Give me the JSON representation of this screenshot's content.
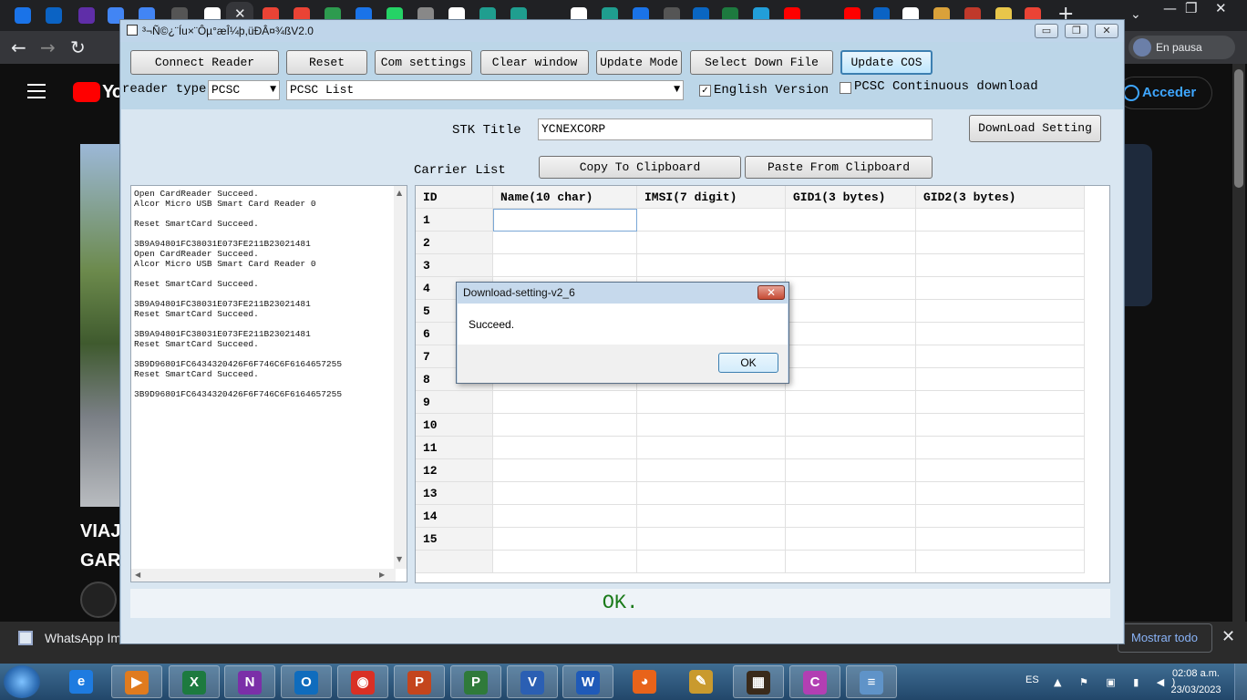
{
  "browser": {
    "active_tab_close": "✕",
    "new_tab": "+",
    "tab_search": "⌄",
    "window_controls": [
      "—",
      "❐",
      "✕"
    ],
    "nav": {
      "back": "←",
      "forward": "→",
      "reload": "↻"
    },
    "profile_status": "En pausa"
  },
  "youtube": {
    "logo_text": "Yo",
    "login_label": "Acceder",
    "video_title_line1": "VIAJ",
    "video_title_line2": "GAR"
  },
  "download_bar": {
    "file_name": "WhatsApp Ima",
    "show_all": "Mostrar todo",
    "close": "✕"
  },
  "app": {
    "title": "³¬Ñ©¿¨Íu×¨Ôµ°æÎ¼þ,üÐÂ¤¾ßV2.0",
    "controls": [
      "▭",
      "❐",
      "✕"
    ],
    "buttons": {
      "connect_reader": "Connect Reader",
      "reset": "Reset",
      "com_settings": "Com settings",
      "clear_window": "Clear window",
      "update_mode": "Update Mode",
      "select_down_file": "Select Down File",
      "update_cos": "Update COS",
      "download_setting": "DownLoad Setting",
      "copy_to_clipboard": "Copy To Clipboard",
      "paste_from_clipboard": "Paste From Clipboard"
    },
    "reader_type_label": "reader type",
    "reader_type_value": "PCSC",
    "reader_list_value": "PCSC List",
    "english_version_label": "English Version",
    "english_version_checked": true,
    "pcsc_continuous_label": "PCSC Continuous download",
    "pcsc_continuous_checked": false,
    "stk_title_label": "STK Title",
    "stk_title_value": "YCNEXCORP",
    "carrier_list_label": "Carrier List",
    "log_lines": [
      "Open CardReader Succeed.",
      "Alcor Micro USB Smart Card Reader 0",
      "",
      "Reset SmartCard Succeed.",
      "",
      "3B9A94801FC38031E073FE211B23021481",
      "Open CardReader Succeed.",
      "Alcor Micro USB Smart Card Reader 0",
      "",
      "Reset SmartCard Succeed.",
      "",
      "3B9A94801FC38031E073FE211B23021481",
      "Reset SmartCard Succeed.",
      "",
      "3B9A94801FC38031E073FE211B23021481",
      "Reset SmartCard Succeed.",
      "",
      "3B9D96801FC6434320426F6F746C6F6164657255",
      "Reset SmartCard Succeed.",
      "",
      "3B9D96801FC6434320426F6F746C6F6164657255"
    ],
    "grid": {
      "columns": [
        "ID",
        "Name(10 char)",
        "IMSI(7 digit)",
        "GID1(3 bytes)",
        "GID2(3 bytes)"
      ],
      "row_ids": [
        "1",
        "2",
        "3",
        "4",
        "5",
        "6",
        "7",
        "8",
        "9",
        "10",
        "11",
        "12",
        "13",
        "14",
        "15"
      ]
    },
    "status_text": "OK."
  },
  "dialog": {
    "title": "Download-setting-v2_6",
    "message": "Succeed.",
    "ok_label": "OK",
    "close": "✕"
  },
  "taskbar": {
    "language": "ES",
    "time": "02:08 a.m.",
    "date": "23/03/2023",
    "apps": [
      {
        "name": "internet-explorer",
        "glyph": "e",
        "color": "#1e7be0"
      },
      {
        "name": "media-player",
        "glyph": "▶",
        "color": "#e07b1e"
      },
      {
        "name": "excel",
        "glyph": "X",
        "color": "#1d7a3f"
      },
      {
        "name": "onenote",
        "glyph": "N",
        "color": "#7b2fa8"
      },
      {
        "name": "outlook",
        "glyph": "O",
        "color": "#0f6cbd"
      },
      {
        "name": "chrome",
        "glyph": "◉",
        "color": "#d93025"
      },
      {
        "name": "powerpoint",
        "glyph": "P",
        "color": "#c4451d"
      },
      {
        "name": "project",
        "glyph": "P",
        "color": "#2f7a3a"
      },
      {
        "name": "visio",
        "glyph": "V",
        "color": "#2b5fb3"
      },
      {
        "name": "word",
        "glyph": "W",
        "color": "#1f5ab8"
      },
      {
        "name": "firefox",
        "glyph": "◕",
        "color": "#e8631a"
      },
      {
        "name": "paint",
        "glyph": "✎",
        "color": "#c99a2e"
      },
      {
        "name": "chip-tool",
        "glyph": "▦",
        "color": "#3a2a1a"
      },
      {
        "name": "ide",
        "glyph": "C",
        "color": "#b23fb3"
      },
      {
        "name": "notepad",
        "glyph": "≡",
        "color": "#5f93c8"
      }
    ],
    "tray_icons": "▲ ⚑ ▣ ▮ ◀)"
  }
}
